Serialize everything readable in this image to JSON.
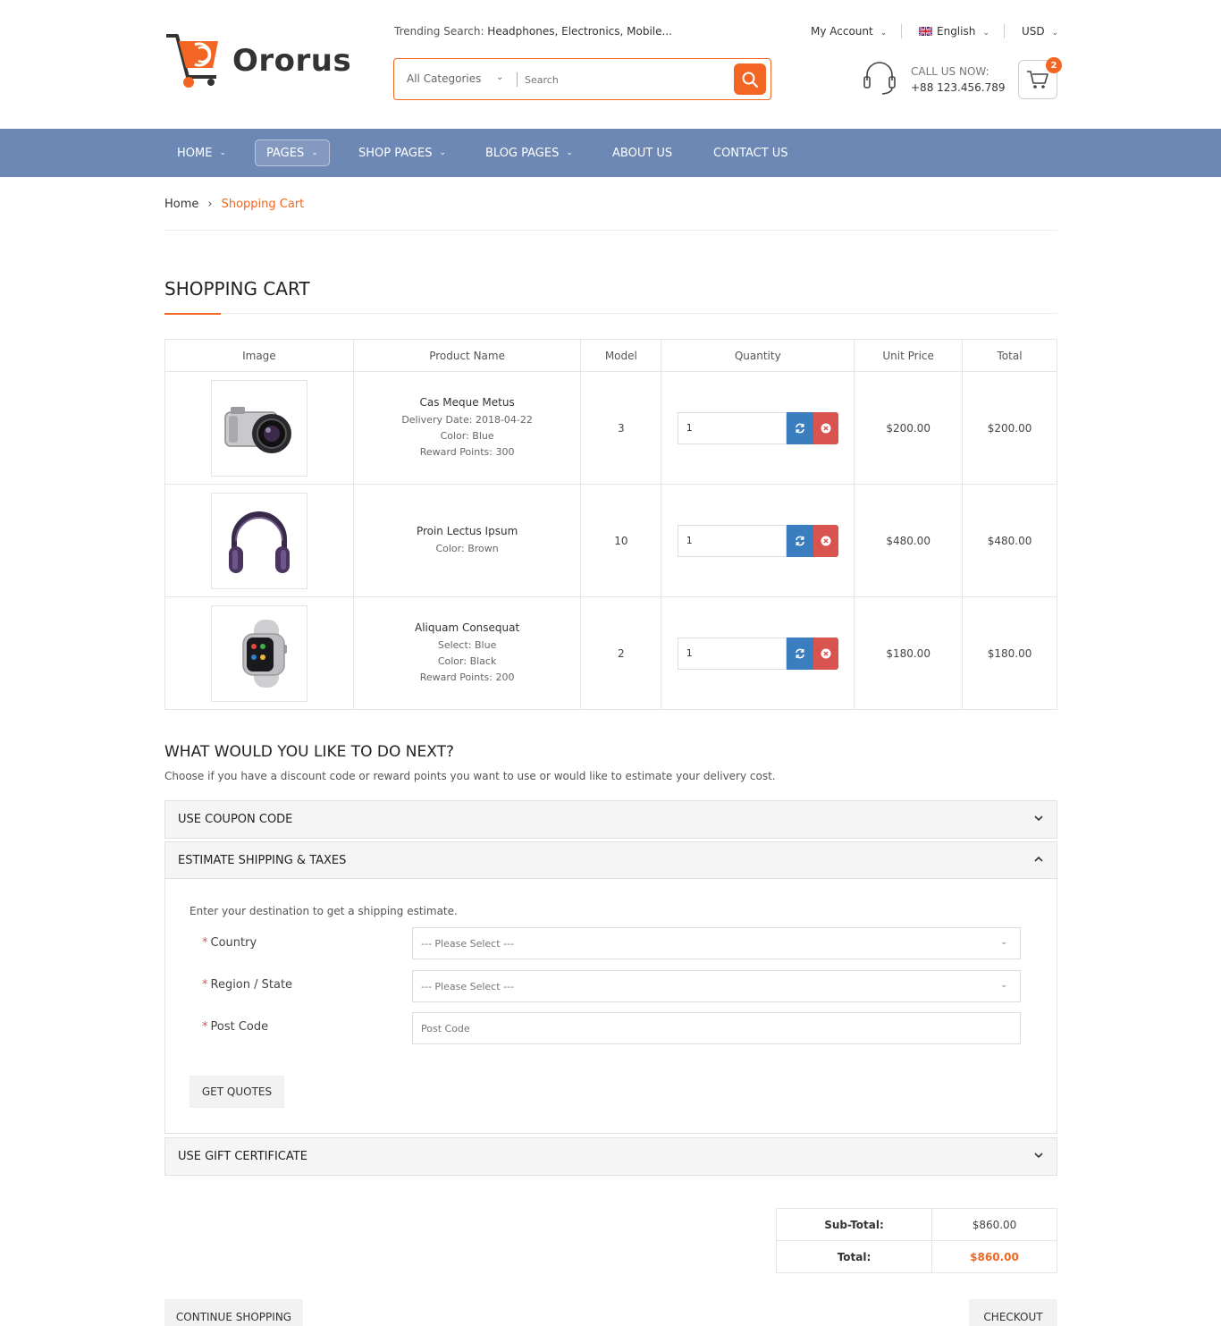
{
  "brand": {
    "name": "Ororus",
    "accent": "#f26522",
    "nav_bg": "#6e88b5"
  },
  "header": {
    "trending_label": "Trending Search:",
    "trending_items": " Headphones, Electronics, Mobile...",
    "search": {
      "category": "All Categories",
      "placeholder": "Search"
    },
    "my_account": "My Account",
    "language": "English",
    "currency": "USD",
    "call_label": "CALL US NOW:",
    "call_number": "+88 123.456.789",
    "cart_count": "2"
  },
  "nav": {
    "home": "HOME",
    "pages": "PAGES",
    "shop_pages": "SHOP PAGES",
    "blog_pages": "BLOG PAGES",
    "about": "ABOUT US",
    "contact": "CONTACT US"
  },
  "breadcrumb": {
    "home": "Home",
    "current": "Shopping Cart"
  },
  "page_title": "SHOPPING CART",
  "cart": {
    "headers": {
      "image": "Image",
      "name": "Product Name",
      "model": "Model",
      "quantity": "Quantity",
      "unit_price": "Unit Price",
      "total": "Total"
    },
    "items": [
      {
        "name": "Cas Meque Metus",
        "meta": [
          "Delivery Date: 2018-04-22",
          "Color: Blue",
          "Reward Points: 300"
        ],
        "model": "3",
        "qty": "1",
        "unit_price": "$200.00",
        "total": "$200.00",
        "image_icon": "camera-icon"
      },
      {
        "name": "Proin Lectus Ipsum",
        "meta": [
          "Color: Brown"
        ],
        "model": "10",
        "qty": "1",
        "unit_price": "$480.00",
        "total": "$480.00",
        "image_icon": "headphones-icon"
      },
      {
        "name": "Aliquam Consequat",
        "meta": [
          "Select: Blue",
          "Color: Black",
          "Reward Points: 200"
        ],
        "model": "2",
        "qty": "1",
        "unit_price": "$180.00",
        "total": "$180.00",
        "image_icon": "smartwatch-icon"
      }
    ]
  },
  "next": {
    "title": "WHAT WOULD YOU LIKE TO DO NEXT?",
    "description": "Choose if you have a discount code or reward points you want to use or would like to estimate your delivery cost."
  },
  "panels": {
    "coupon": "USE COUPON CODE",
    "shipping": "ESTIMATE SHIPPING & TAXES",
    "gift": "USE GIFT CERTIFICATE"
  },
  "shipping_form": {
    "description": "Enter your destination to get a shipping estimate.",
    "country_label": "Country",
    "country_value": " --- Please Select --- ",
    "region_label": "Region / State",
    "region_value": " --- Please Select --- ",
    "postcode_label": "Post Code",
    "postcode_placeholder": "Post Code",
    "get_quotes": "GET QUOTES"
  },
  "totals": {
    "subtotal_label": "Sub-Total:",
    "subtotal_value": "$860.00",
    "total_label": "Total:",
    "total_value": "$860.00"
  },
  "actions": {
    "continue": "CONTINUE SHOPPING",
    "checkout": "CHECKOUT"
  }
}
